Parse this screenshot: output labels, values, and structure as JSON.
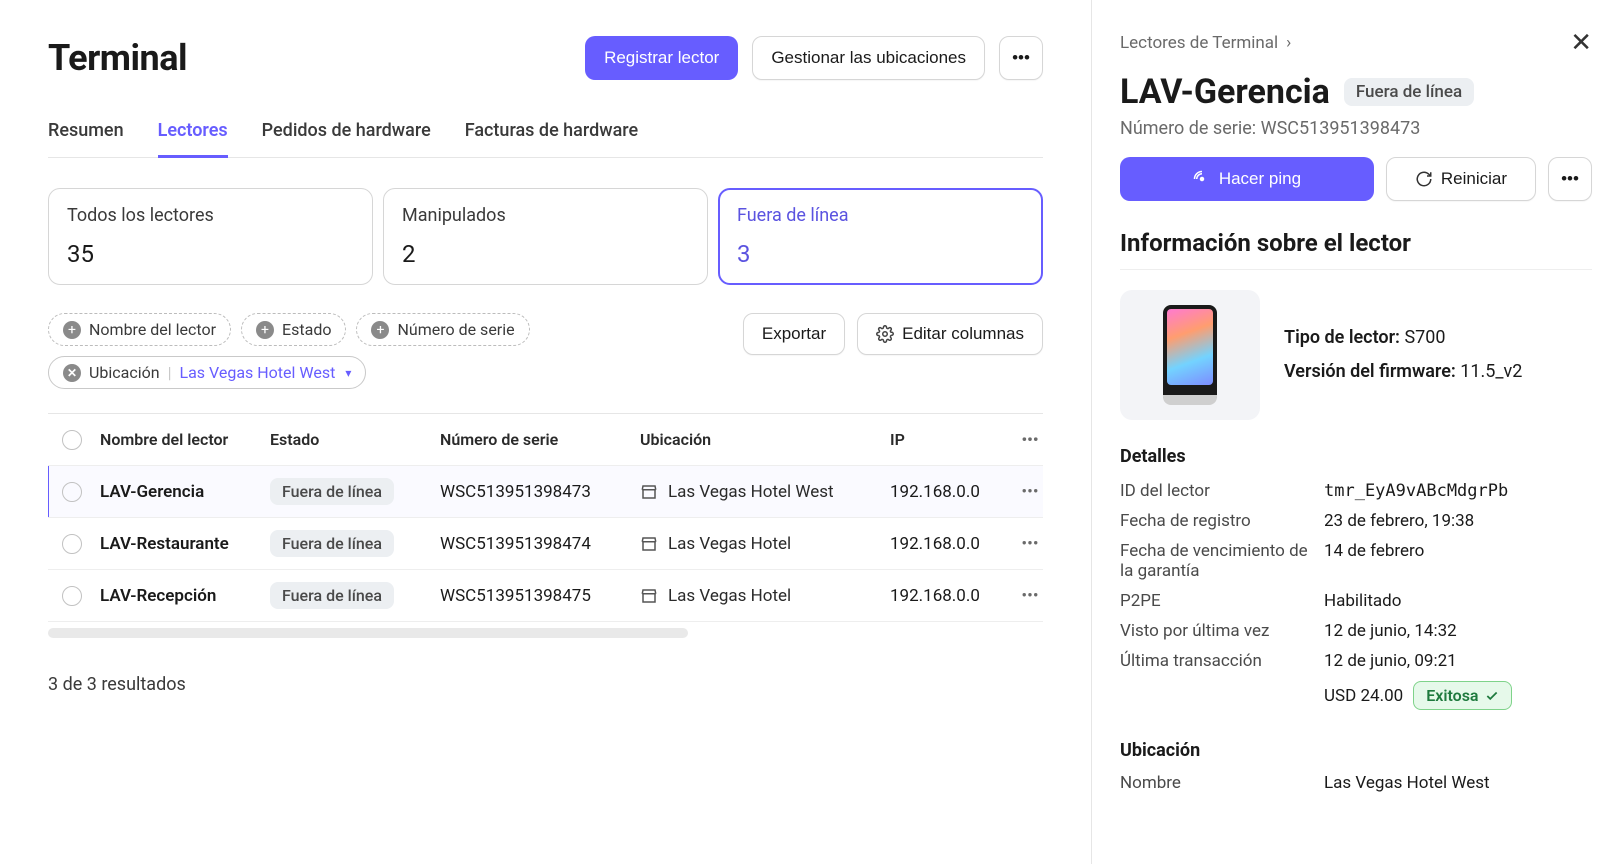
{
  "page": {
    "title": "Terminal",
    "register_btn": "Registrar lector",
    "manage_locations_btn": "Gestionar las ubicaciones"
  },
  "tabs": [
    "Resumen",
    "Lectores",
    "Pedidos de hardware",
    "Facturas de hardware"
  ],
  "active_tab_index": 1,
  "stats": [
    {
      "label": "Todos los lectores",
      "value": "35"
    },
    {
      "label": "Manipulados",
      "value": "2"
    },
    {
      "label": "Fuera de línea",
      "value": "3"
    }
  ],
  "active_stat_index": 2,
  "filter_chips": {
    "name": "Nombre del lector",
    "state": "Estado",
    "serial": "Número de serie",
    "location_label": "Ubicación",
    "location_value": "Las Vegas Hotel West"
  },
  "table_actions": {
    "export": "Exportar",
    "edit_columns": "Editar columnas"
  },
  "columns": [
    "Nombre del lector",
    "Estado",
    "Número de serie",
    "Ubicación",
    "IP"
  ],
  "rows": [
    {
      "name": "LAV-Gerencia",
      "state": "Fuera de línea",
      "serial": "WSC513951398473",
      "location": "Las Vegas Hotel West",
      "ip": "192.168.0.0"
    },
    {
      "name": "LAV-Restaurante",
      "state": "Fuera de línea",
      "serial": "WSC513951398474",
      "location": "Las Vegas Hotel",
      "ip": "192.168.0.0"
    },
    {
      "name": "LAV-Recepción",
      "state": "Fuera de línea",
      "serial": "WSC513951398475",
      "location": "Las Vegas Hotel",
      "ip": "192.168.0.0"
    }
  ],
  "results_text": "3 de 3 resultados",
  "detail": {
    "breadcrumb": "Lectores de Terminal",
    "title": "LAV-Gerencia",
    "status": "Fuera de línea",
    "serial_label": "Número de serie:",
    "serial_value": "WSC513951398473",
    "ping_btn": "Hacer ping",
    "restart_btn": "Reiniciar",
    "section_info": "Información sobre el lector",
    "reader_type_label": "Tipo de lector:",
    "reader_type_value": "S700",
    "firmware_label": "Versión del firmware:",
    "firmware_value": "11.5_v2",
    "details_heading": "Detalles",
    "kv": {
      "id_label": "ID del lector",
      "id_value": "tmr_EyA9vABcMdgrPb",
      "registered_label": "Fecha de registro",
      "registered_value": "23 de febrero, 19:38",
      "warranty_label": "Fecha de vencimiento de la garantía",
      "warranty_value": "14 de febrero",
      "p2pe_label": "P2PE",
      "p2pe_value": "Habilitado",
      "last_seen_label": "Visto por última vez",
      "last_seen_value": "12 de junio, 14:32",
      "last_tx_label": "Última transacción",
      "last_tx_value": "12 de junio, 09:21",
      "amount": "USD 24.00",
      "success_badge": "Exitosa"
    },
    "location_heading": "Ubicación",
    "location_name_label": "Nombre",
    "location_name_value": "Las Vegas Hotel West"
  }
}
